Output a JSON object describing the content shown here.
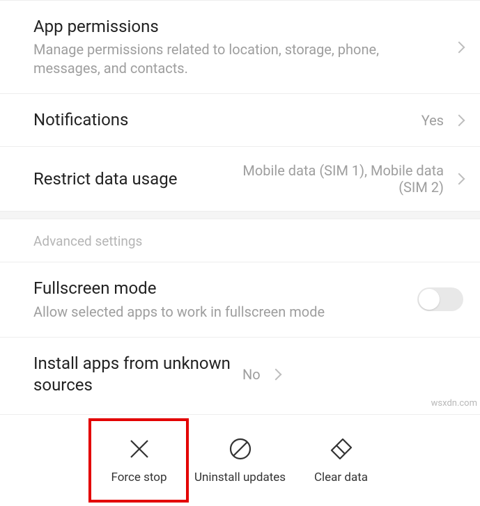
{
  "items": {
    "appPermissions": {
      "title": "App permissions",
      "subtitle": "Manage permissions related to location, storage, phone, messages, and contacts."
    },
    "notifications": {
      "title": "Notifications",
      "value": "Yes"
    },
    "restrictData": {
      "title": "Restrict data usage",
      "value": "Mobile data (SIM 1), Mobile data (SIM 2)"
    },
    "advancedHeader": "Advanced settings",
    "fullscreen": {
      "title": "Fullscreen mode",
      "subtitle": "Allow selected apps to work in fullscreen mode",
      "enabled": false
    },
    "unknownSources": {
      "title": "Install apps from unknown sources",
      "value": "No"
    }
  },
  "actions": {
    "forceStop": "Force stop",
    "uninstallUpdates": "Uninstall updates",
    "clearData": "Clear data"
  },
  "watermark": "wsxdn.com"
}
